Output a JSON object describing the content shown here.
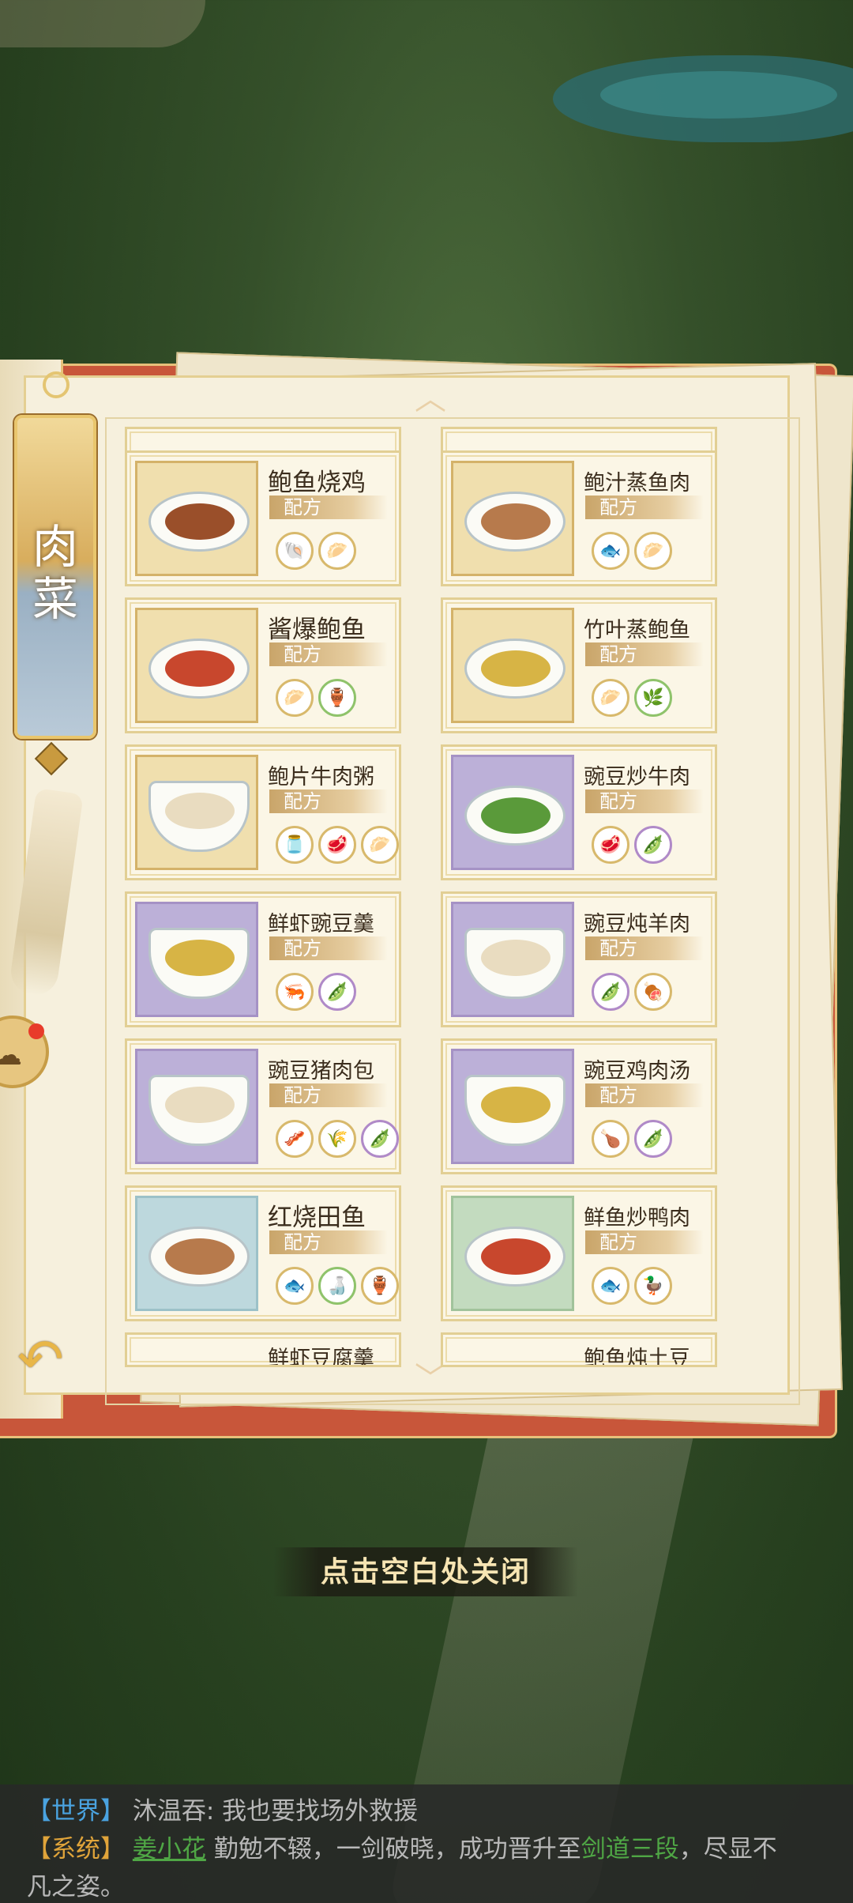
{
  "category": {
    "label": "肉菜"
  },
  "formula_label": "配方",
  "recipes": [
    {
      "name": "鲍鱼烧鸡",
      "ingredients": [
        "shell-icon",
        "abalone-icon"
      ]
    },
    {
      "name": "鲍汁蒸鱼肉",
      "ingredients": [
        "fish-meat-icon",
        "abalone-icon"
      ]
    },
    {
      "name": "酱爆鲍鱼",
      "ingredients": [
        "abalone-icon",
        "sauce-jar-icon"
      ]
    },
    {
      "name": "竹叶蒸鲍鱼",
      "ingredients": [
        "abalone-icon",
        "bamboo-leaf-icon"
      ]
    },
    {
      "name": "鲍片牛肉粥",
      "ingredients": [
        "rice-jar-icon",
        "beef-icon",
        "abalone-icon"
      ]
    },
    {
      "name": "豌豆炒牛肉",
      "ingredients": [
        "beef-icon",
        "peas-icon"
      ]
    },
    {
      "name": "鲜虾豌豆羹",
      "ingredients": [
        "shrimp-icon",
        "peas-icon"
      ]
    },
    {
      "name": "豌豆炖羊肉",
      "ingredients": [
        "peas-icon",
        "mutton-icon"
      ]
    },
    {
      "name": "豌豆猪肉包",
      "ingredients": [
        "pork-icon",
        "flour-icon",
        "peas-icon"
      ]
    },
    {
      "name": "豌豆鸡肉汤",
      "ingredients": [
        "chicken-icon",
        "peas-icon"
      ]
    },
    {
      "name": "红烧田鱼",
      "ingredients": [
        "fish-meat-icon",
        "soy-sauce-icon",
        "sauce-jar-icon"
      ]
    },
    {
      "name": "鲜鱼炒鸭肉",
      "ingredients": [
        "fish-meat-icon",
        "duck-icon"
      ]
    }
  ],
  "partial_recipes": [
    "鲜虾豆腐羹",
    "鲍鱼炖土豆"
  ],
  "close_hint": "点击空白处关闭",
  "chat": {
    "line1": {
      "channel": "【世界】",
      "speaker": "沐温吞:",
      "text": "我也要找场外救援"
    },
    "line2": {
      "channel": "【系统】",
      "name": "姜小花",
      "text_a": "勤勉不辍，一剑破晓，成功晋升至",
      "rank": "剑道三段",
      "text_b": "，尽显不",
      "text_c": "凡之姿。"
    }
  },
  "colors": {
    "accent_gold": "#e2cf94",
    "cover_red": "#c8563a",
    "chat_channel": "#4aa3e0",
    "system_channel": "#e0a43a",
    "highlight_green": "#4fa745"
  }
}
